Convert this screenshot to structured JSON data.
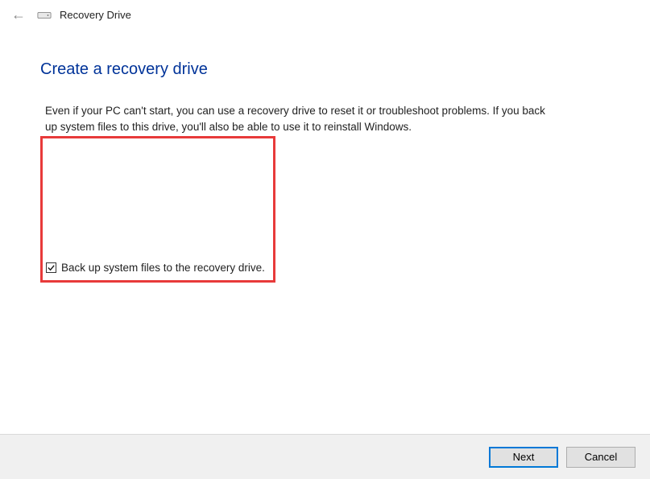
{
  "titleBar": {
    "windowTitle": "Recovery Drive"
  },
  "content": {
    "heading": "Create a recovery drive",
    "description": "Even if your PC can't start, you can use a recovery drive to reset it or troubleshoot problems. If you back up system files to this drive, you'll also be able to use it to reinstall Windows."
  },
  "checkbox": {
    "label": "Back up system files to the recovery drive.",
    "checked": true
  },
  "footer": {
    "nextLabel": "Next",
    "cancelLabel": "Cancel"
  }
}
